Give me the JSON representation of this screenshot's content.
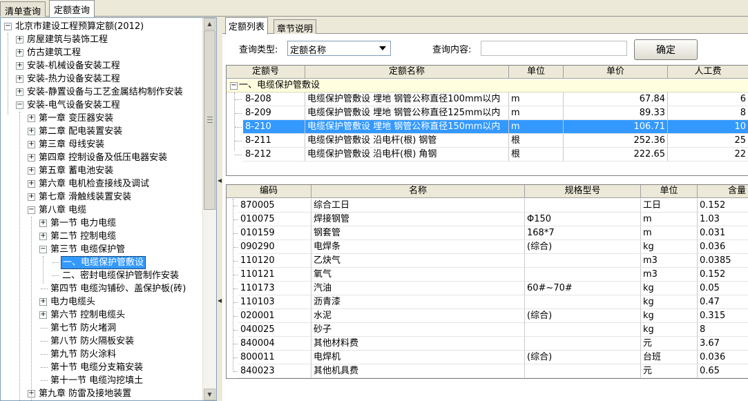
{
  "top_tabs": [
    "清单查询",
    "定额查询"
  ],
  "tree": {
    "items": [
      {
        "label": "北京市建设工程预算定额(2012)",
        "toggle": "−",
        "selected": false
      },
      {
        "label": "房屋建筑与装饰工程",
        "toggle": "+",
        "selected": false
      },
      {
        "label": "仿古建筑工程",
        "toggle": "+",
        "selected": false
      },
      {
        "label": "安装-机械设备安装工程",
        "toggle": "+",
        "selected": false
      },
      {
        "label": "安装-热力设备安装工程",
        "toggle": "+",
        "selected": false
      },
      {
        "label": "安装-静置设备与工艺金属结构制作安装",
        "toggle": "+",
        "selected": false
      },
      {
        "label": "安装-电气设备安装工程",
        "toggle": "−",
        "selected": false
      },
      {
        "label": "第一章  变压器安装",
        "toggle": "+",
        "selected": false
      },
      {
        "label": "第二章  配电装置安装",
        "toggle": "+",
        "selected": false
      },
      {
        "label": "第三章  母线安装",
        "toggle": "+",
        "selected": false
      },
      {
        "label": "第四章  控制设备及低压电器安装",
        "toggle": "+",
        "selected": false
      },
      {
        "label": "第五章  蓄电池安装",
        "toggle": "+",
        "selected": false
      },
      {
        "label": "第六章  电机检查接线及调试",
        "toggle": "+",
        "selected": false
      },
      {
        "label": "第七章  滑触线装置安装",
        "toggle": "+",
        "selected": false
      },
      {
        "label": "第八章  电缆",
        "toggle": "−",
        "selected": false
      },
      {
        "label": "第一节  电力电缆",
        "toggle": "+",
        "selected": false
      },
      {
        "label": "第二节  控制电缆",
        "toggle": "+",
        "selected": false
      },
      {
        "label": "第三节  电缆保护管",
        "toggle": "−",
        "selected": false
      },
      {
        "label": "一、电缆保护管敷设",
        "toggle": "",
        "selected": true
      },
      {
        "label": "二、密封电缆保护管制作安装",
        "toggle": "",
        "selected": false
      },
      {
        "label": "第四节  电缆沟铺砂、盖保护板(砖)",
        "toggle": "",
        "selected": false
      },
      {
        "label": "电力电缆头",
        "toggle": "+",
        "selected": false
      },
      {
        "label": "第六节  控制电缆头",
        "toggle": "+",
        "selected": false
      },
      {
        "label": "第七节  防火堵洞",
        "toggle": "",
        "selected": false
      },
      {
        "label": "第八节  防火隔板安装",
        "toggle": "",
        "selected": false
      },
      {
        "label": "第九节  防火涂料",
        "toggle": "",
        "selected": false
      },
      {
        "label": "第十节  电缆分支箱安装",
        "toggle": "",
        "selected": false
      },
      {
        "label": "第十一节  电缆沟挖填土",
        "toggle": "",
        "selected": false
      },
      {
        "label": "第九章  防雷及接地装置",
        "toggle": "+",
        "selected": false
      }
    ]
  },
  "sub_tabs": [
    "定额列表",
    "章节说明"
  ],
  "query": {
    "type_label": "查询类型:",
    "type_value": "定额名称",
    "content_label": "查询内容:",
    "content_value": "",
    "ok_label": "确定"
  },
  "quota_table": {
    "headers": [
      "定额号",
      "定额名称",
      "单位",
      "单价",
      "人工费"
    ],
    "group_label": "一、电缆保护管敷设",
    "group_toggle": "−",
    "rows": [
      {
        "code": "8-208",
        "name": "电缆保护管敷设 埋地 钢管公称直径100mm以内",
        "unit": "m",
        "price": "67.84",
        "labor": "6",
        "selected": false
      },
      {
        "code": "8-209",
        "name": "电缆保护管敷设 埋地 钢管公称直径125mm以内",
        "unit": "m",
        "price": "89.33",
        "labor": "8",
        "selected": false
      },
      {
        "code": "8-210",
        "name": "电缆保护管敷设 埋地 钢管公称直径150mm以内",
        "unit": "m",
        "price": "106.71",
        "labor": "10",
        "selected": true
      },
      {
        "code": "8-211",
        "name": "电缆保护管敷设 沿电杆(根) 钢管",
        "unit": "根",
        "price": "252.36",
        "labor": "25",
        "selected": false
      },
      {
        "code": "8-212",
        "name": "电缆保护管敷设 沿电杆(根) 角钢",
        "unit": "根",
        "price": "222.65",
        "labor": "22",
        "selected": false
      }
    ]
  },
  "resource_table": {
    "headers": [
      "编码",
      "名称",
      "规格型号",
      "单位",
      "含量"
    ],
    "rows": [
      {
        "code": "870005",
        "name": "综合工日",
        "spec": "",
        "unit": "工日",
        "qty": "0.152"
      },
      {
        "code": "010075",
        "name": "焊接钢管",
        "spec": "Φ150",
        "unit": "m",
        "qty": "1.03"
      },
      {
        "code": "010159",
        "name": "钢套管",
        "spec": "168*7",
        "unit": "m",
        "qty": "0.031"
      },
      {
        "code": "090290",
        "name": "电焊条",
        "spec": "(综合)",
        "unit": "kg",
        "qty": "0.036"
      },
      {
        "code": "110120",
        "name": "乙炔气",
        "spec": "",
        "unit": "m3",
        "qty": "0.0385"
      },
      {
        "code": "110121",
        "name": "氧气",
        "spec": "",
        "unit": "m3",
        "qty": "0.152"
      },
      {
        "code": "110173",
        "name": "汽油",
        "spec": "60#~70#",
        "unit": "kg",
        "qty": "0.05"
      },
      {
        "code": "110103",
        "name": "沥青漆",
        "spec": "",
        "unit": "kg",
        "qty": "0.47"
      },
      {
        "code": "020001",
        "name": "水泥",
        "spec": "(综合)",
        "unit": "kg",
        "qty": "0.315"
      },
      {
        "code": "040025",
        "name": "砂子",
        "spec": "",
        "unit": "kg",
        "qty": "8"
      },
      {
        "code": "840004",
        "name": "其他材料费",
        "spec": "",
        "unit": "元",
        "qty": "3.67"
      },
      {
        "code": "800011",
        "name": "电焊机",
        "spec": "(综合)",
        "unit": "台班",
        "qty": "0.036"
      },
      {
        "code": "840023",
        "name": "其他机具费",
        "spec": "",
        "unit": "元",
        "qty": "0.65"
      }
    ]
  },
  "icons": {
    "tree_expand": "plus-box-icon",
    "tree_collapse": "minus-box-icon",
    "dropdown": "triangle-down-icon",
    "splitter": "triangle-left-icon"
  },
  "colors": {
    "selection": "#3399ff",
    "group_row": "#ffffe0",
    "window_bg": "#ece9d8"
  }
}
